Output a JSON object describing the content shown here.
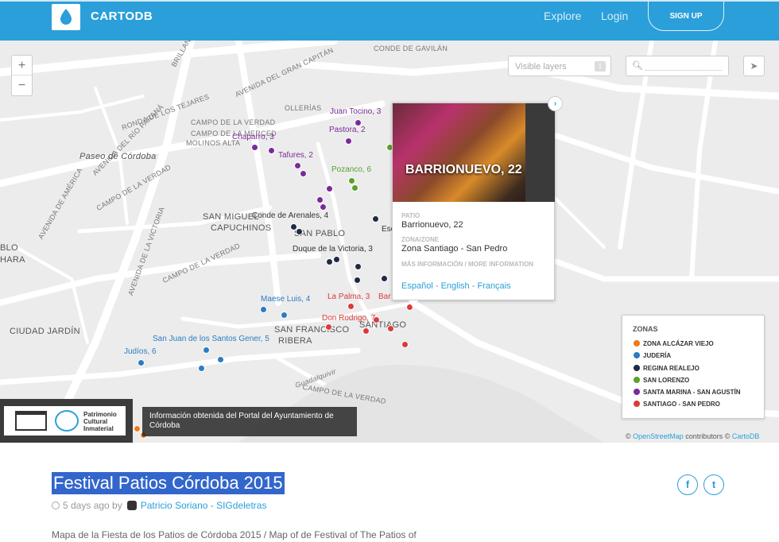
{
  "header": {
    "logo_text": "CARTODB",
    "nav": [
      "Explore",
      "Login"
    ],
    "signup_label": "SIGN UP",
    "accent_color": "#2b9fd9"
  },
  "map_controls": {
    "zoom_in": "+",
    "zoom_out": "−",
    "layers_placeholder": "Visible layers",
    "layers_count": "1",
    "search_placeholder": "",
    "share_icon": "paper-plane-icon"
  },
  "streets": [
    "BRILLANTE",
    "AVENIDA DEL GRAN CAPITÁN",
    "AVENIDA DEL RÍO PARANÁ",
    "RONDA DE LOS TEJARES",
    "CONDE DE GAVILÁN",
    "OLLERÍAS",
    "CAMPO DE LA VERDAD",
    "CAMPO DE LA MERCED",
    "MOLINOS ALTA",
    "Paseo de Córdoba",
    "AVENIDA DE AMÉRICA",
    "CAMPO DE LA VERDAD",
    "SAN MIGUEL",
    "CAPUCHINOS",
    "SAN PABLO",
    "AVENIDA DE LA VICTORIA",
    "CAMPO DE LA VERDAD",
    "CIUDAD JARDÍN",
    "SAN FRANCISCO",
    "RIBERA",
    "SANTIAGO",
    "Guadalquivir",
    "CAMPO DE LA VERDAD",
    "HARA",
    "BLO"
  ],
  "pois": [
    {
      "label": "Juan Tocino, 3",
      "color": "#7b2a9a"
    },
    {
      "label": "Pastora, 2",
      "color": "#7b2a9a"
    },
    {
      "label": "Chaparro, 3",
      "color": "#7b2a9a"
    },
    {
      "label": "Tafures, 2",
      "color": "#7b2a9a"
    },
    {
      "label": "Pozanco, 6",
      "color": "#5aa02c"
    },
    {
      "label": "Conde de Arenales, 4",
      "color": "#333333"
    },
    {
      "label": "Esc",
      "color": "#333333"
    },
    {
      "label": "Duque de la Victoria, 3",
      "color": "#333333"
    },
    {
      "label": "La Palma, 3",
      "color": "#d93c3c"
    },
    {
      "label": "Bar",
      "color": "#d93c3c"
    },
    {
      "label": "Maese Luis, 4",
      "color": "#2b7cc4"
    },
    {
      "label": "Don Rodrigo, 7",
      "color": "#d93c3c"
    },
    {
      "label": "San Juan de los Santos Gener, 5",
      "color": "#2b7cc4"
    },
    {
      "label": "Judíos, 6",
      "color": "#2b7cc4"
    }
  ],
  "popup": {
    "title": "BARRIONUEVO, 22",
    "patio_label": "PATIO",
    "patio_value": "Barrionuevo, 22",
    "zone_label": "ZONA/ZONE",
    "zone_value": "Zona Santiago - San Pedro",
    "more_label": "MÁS INFORMACIÓN / MORE INFORMATION",
    "links": [
      "Español",
      "English",
      "Français"
    ],
    "separator": "-",
    "next_icon": "chevron-right-icon"
  },
  "legend": {
    "title": "ZONAS",
    "items": [
      {
        "label": "ZONA ALCÁZAR VIEJO",
        "color": "#f07a1a"
      },
      {
        "label": "JUDERÍA",
        "color": "#2b7cc4"
      },
      {
        "label": "REGINA REALEJO",
        "color": "#1f2a44"
      },
      {
        "label": "SAN LORENZO",
        "color": "#5aa02c"
      },
      {
        "label": "SANTA MARINA - SAN AGUSTÍN",
        "color": "#7b2a9a"
      },
      {
        "label": "SANTIAGO - SAN PEDRO",
        "color": "#d93c3c"
      }
    ]
  },
  "attribution": {
    "prefix": "©",
    "osm": "OpenStreetMap",
    "middle": "contributors ©",
    "cartodb": "CartoDB"
  },
  "overlay": {
    "badge_text": "Patrimonio Cultural Inmaterial",
    "info_text": "Información obtenida del Portal del Ayuntamiento de Córdoba"
  },
  "page": {
    "title": "Festival Patios Córdoba 2015",
    "time_ago": "5 days ago by",
    "author": "Patricio Soriano - SIGdeletras",
    "description": "Mapa de la Fiesta de los Patios de Córdoba 2015 / Map of de Festival of The Patios of"
  },
  "social": {
    "facebook": "f",
    "twitter": "t"
  }
}
